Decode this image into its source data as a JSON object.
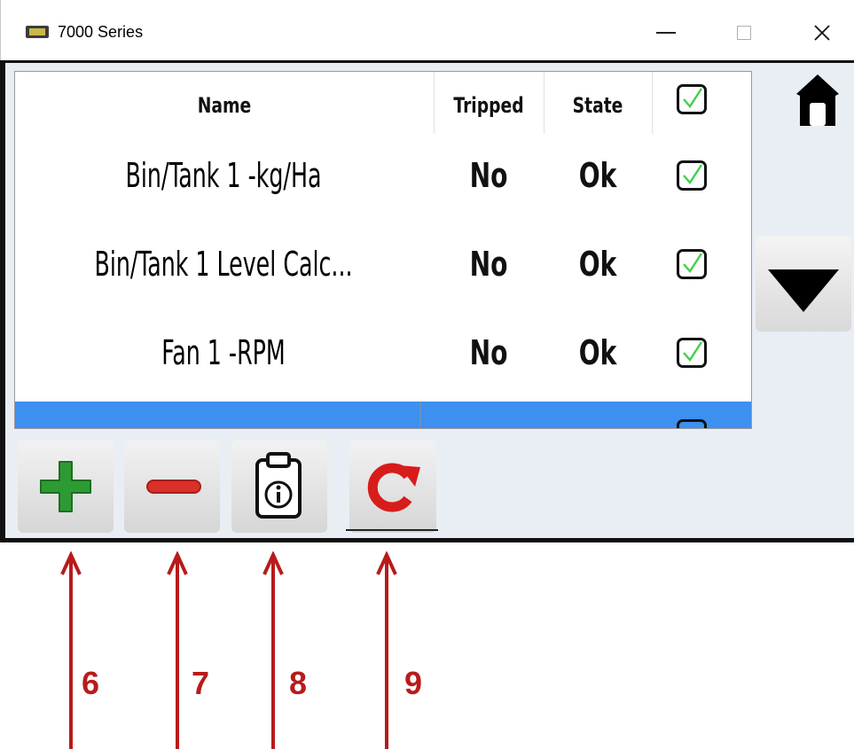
{
  "window": {
    "title": "7000 Series"
  },
  "table": {
    "headers": {
      "name": "Name",
      "tripped": "Tripped",
      "state": "State"
    },
    "rows": [
      {
        "name": "Bin/Tank 1 -kg/Ha",
        "tripped": "No",
        "state": "Ok",
        "checked": true
      },
      {
        "name": "Bin/Tank 1 Level Calc...",
        "tripped": "No",
        "state": "Ok",
        "checked": true
      },
      {
        "name": "Fan 1 -RPM",
        "tripped": "No",
        "state": "Ok",
        "checked": true
      }
    ]
  },
  "toolbar": {
    "buttons": [
      {
        "icon": "plus-icon",
        "color": "#2e9a33"
      },
      {
        "icon": "minus-icon",
        "color": "#d9302a"
      },
      {
        "icon": "clipboard-info-icon",
        "color": "#111111"
      },
      {
        "icon": "refresh-icon",
        "color": "#d81c1c"
      }
    ]
  },
  "annotations": {
    "labels": [
      "6",
      "7",
      "8",
      "9"
    ],
    "color": "#b81b1b"
  },
  "colors": {
    "selection": "#3d8ff0",
    "check": "#3fd14a"
  }
}
